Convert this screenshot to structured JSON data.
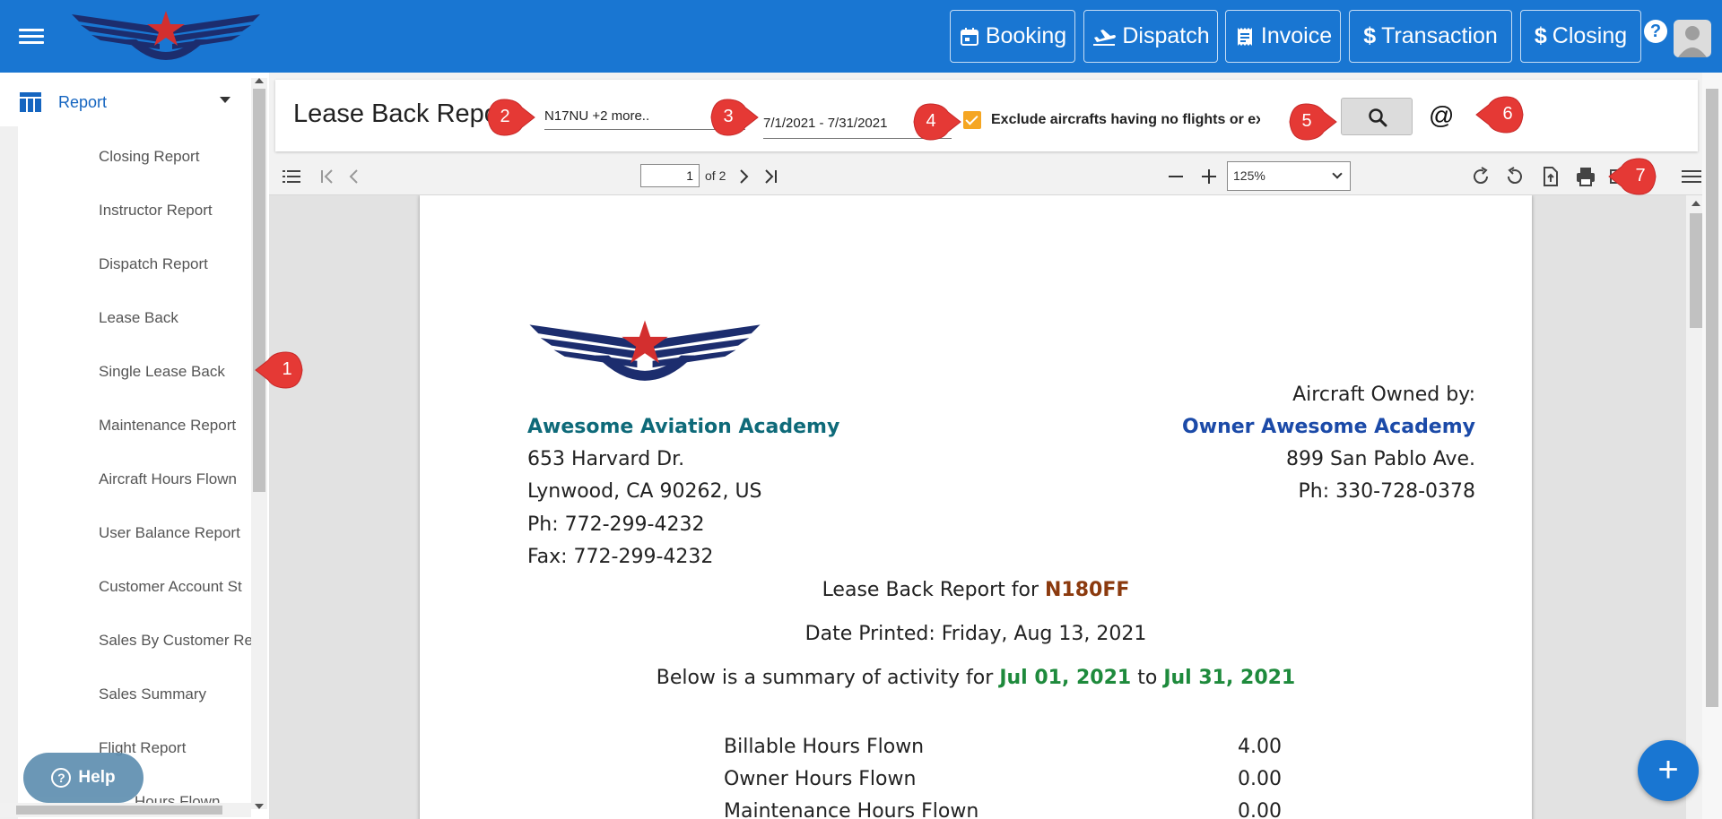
{
  "topbar": {
    "nav": [
      {
        "label": "Booking",
        "icon": "calendar-icon"
      },
      {
        "label": "Dispatch",
        "icon": "plane-takeoff-icon"
      },
      {
        "label": "Invoice",
        "icon": "receipt-icon"
      },
      {
        "label": "Transaction",
        "icon": "dollar-icon"
      },
      {
        "label": "Closing",
        "icon": "dollar-icon"
      }
    ],
    "help_glyph": "?"
  },
  "sidebar": {
    "section_label": "Report",
    "items": [
      "Closing Report",
      "Instructor Report",
      "Dispatch Report",
      "Lease Back",
      "Single Lease Back",
      "Maintenance Report",
      "Aircraft Hours Flown",
      "User Balance Report",
      "Customer Account St",
      "Sales By Customer Re",
      "Sales Summary",
      "Flight Report",
      "Hours Flown"
    ],
    "help_label": "Help"
  },
  "report": {
    "title": "Lease Back Report",
    "aircraft_value": "N17NU   +2 more..",
    "date_range_value": "7/1/2021 - 7/31/2021",
    "exclude_label": "Exclude aircrafts having no flights or expenses",
    "exclude_checked": true,
    "email_symbol": "@"
  },
  "pdf_toolbar": {
    "current_page": "1",
    "page_of": "of 2",
    "zoom": "125%"
  },
  "document": {
    "school_name": "Awesome Aviation Academy",
    "school_address1": "653 Harvard Dr.",
    "school_address2": "Lynwood, CA 90262, US",
    "school_phone": "Ph: 772-299-4232",
    "school_fax": "Fax: 772-299-4232",
    "owned_by_label": "Aircraft Owned by:",
    "owner_name": "Owner Awesome Academy",
    "owner_address": "899 San Pablo Ave.",
    "owner_phone": "Ph: 330-728-0378",
    "report_for_prefix": "Lease Back Report for",
    "tail_number": "N180FF",
    "date_printed": "Date Printed: Friday, Aug 13, 2021",
    "summary_prefix": "Below is a summary of activity for",
    "period_start": "Jul 01, 2021",
    "summary_to": "to",
    "period_end": "Jul 31, 2021",
    "rows": [
      {
        "label": "Billable Hours Flown",
        "value": "4.00"
      },
      {
        "label": "Owner Hours Flown",
        "value": "0.00"
      },
      {
        "label": "Maintenance Hours Flown",
        "value": "0.00"
      }
    ]
  },
  "markers": [
    "1",
    "2",
    "3",
    "4",
    "5",
    "6",
    "7"
  ],
  "colors": {
    "topbar": "#1976d2",
    "accent_orange": "#f5a623",
    "marker_red": "#e53935",
    "school_teal": "#0e6a79",
    "owner_blue": "#1b4aa8",
    "tail_brown": "#8b3a0e",
    "period_green": "#1e8a3c"
  }
}
